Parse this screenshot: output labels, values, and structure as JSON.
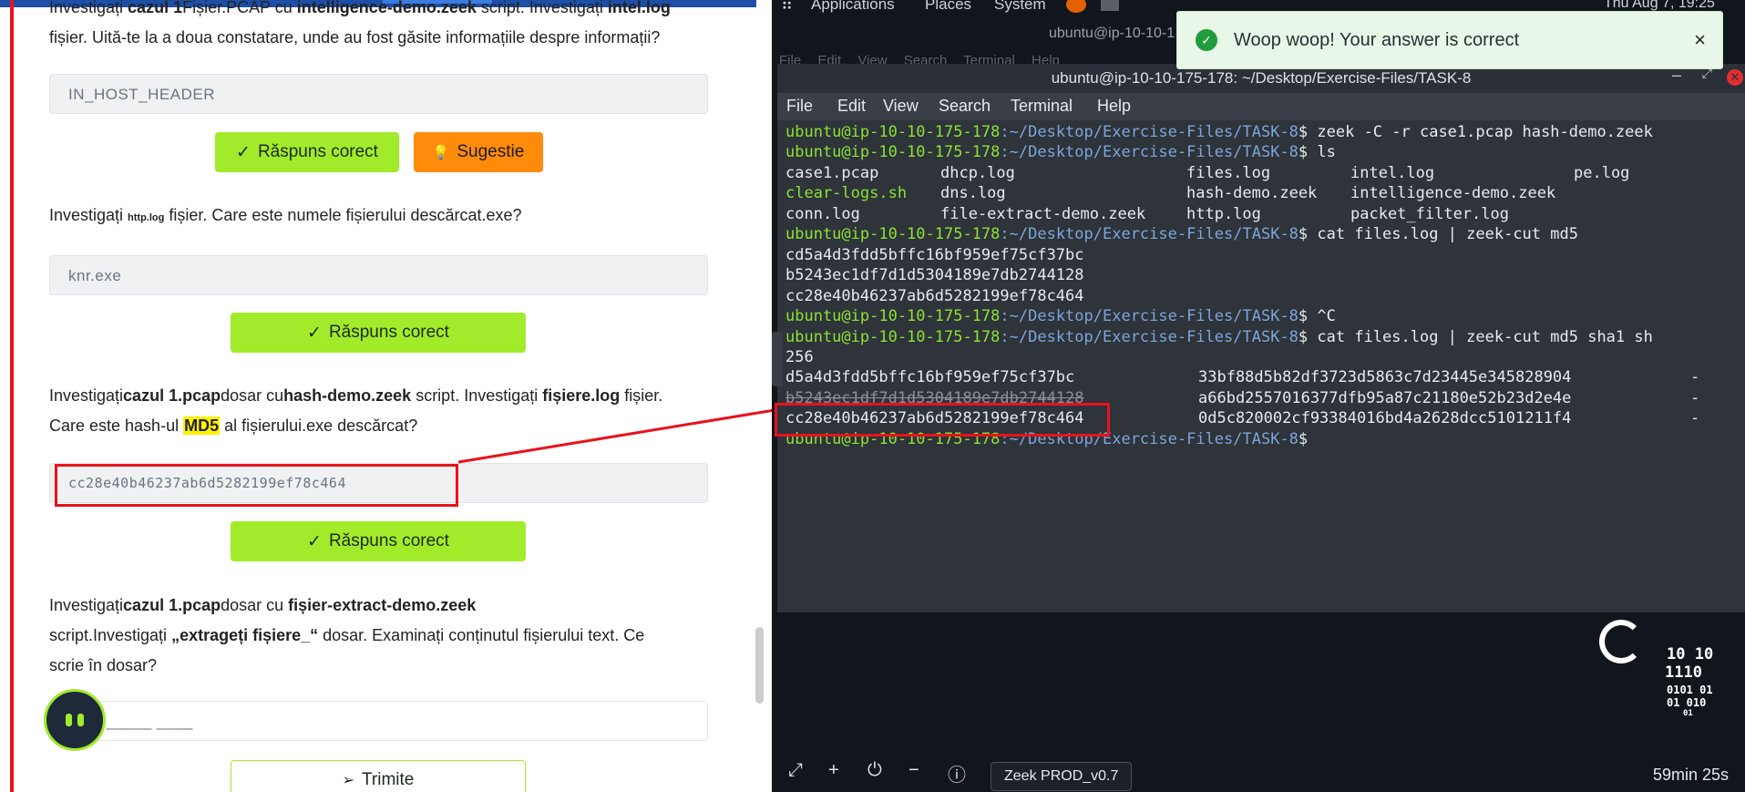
{
  "left": {
    "q1_text_a": "Investigați ",
    "q1_bold_a": "cazul 1",
    "q1_text_b": "Fișier.PCAP cu ",
    "q1_bold_b": "intelligence-demo.zeek",
    "q1_text_c": " script. Investigați ",
    "q1_bold_c": "intel.log",
    "q1_line2": "fișier. Uită-te la a doua constatare, unde au fost găsite informațiile despre informații?",
    "q1_answer": "IN_HOST_HEADER",
    "correct_label": "Răspuns corect",
    "hint_label": "Sugestie",
    "q2_text_a": "Investigați ",
    "q2_small": "http.log",
    "q2_text_b": " fișier. Care este numele fișierului descărcat.exe?",
    "q2_answer": "knr.exe",
    "q3_text_a": "Investigați",
    "q3_bold_a": "cazul 1.pcap",
    "q3_text_b": "dosar cu",
    "q3_bold_b": "hash-demo.zeek",
    "q3_text_c": " script. Investigați ",
    "q3_bold_c": "fișiere.log",
    "q3_text_d": " fișier.",
    "q3_line2_a": "Care este hash-ul ",
    "q3_highlight": "MD5",
    "q3_line2_b": " al fișierului.exe descărcat?",
    "q3_answer": "cc28e40b46237ab6d5282199ef78c464",
    "q4_text_a": "Investigați",
    "q4_bold_a": "cazul 1.pcap",
    "q4_text_b": "dosar cu ",
    "q4_bold_b": "fișier-extract-demo.zeek",
    "q4_line2_a": "script.Investigați ",
    "q4_bold_c": "„extrageți fișiere_“",
    "q4_line2_b": " dosar. Examinați conținutul fișierului text. Ce",
    "q4_line3": "scrie în dosar?",
    "q4_placeholder": "_____ ____",
    "submit_label": "Trimite"
  },
  "desktop": {
    "menu_applications": "Applications",
    "menu_places": "Places",
    "menu_system": "System",
    "clock": "Thu Aug 7, 19:25",
    "bg_title": "ubuntu@ip-10-10-1",
    "bg_menu": "File  Edit  View  Search  Terminal  Help"
  },
  "terminal": {
    "title": "ubuntu@ip-10-10-175-178: ~/Desktop/Exercise-Files/TASK-8",
    "menu": [
      "File",
      "Edit",
      "View",
      "Search",
      "Terminal",
      "Help"
    ],
    "prompt_host": "ubuntu@ip-10-10-175-178",
    "prompt_path": ":~/Desktop/Exercise-Files/TASK-8",
    "cmd1": "$ zeek -C -r case1.pcap hash-demo.zeek",
    "cmd2": "$ ls",
    "ls_row1": [
      "case1.pcap",
      "dhcp.log",
      "files.log",
      "intel.log",
      "pe.log"
    ],
    "ls_row2": [
      "clear-logs.sh",
      "dns.log",
      "hash-demo.zeek",
      "intelligence-demo.zeek"
    ],
    "ls_row3": [
      "conn.log",
      "file-extract-demo.zeek",
      "http.log",
      "packet_filter.log"
    ],
    "cmd3": "$ cat files.log | zeek-cut md5",
    "md5_1": "cd5a4d3fdd5bffc16bf959ef75cf37bc",
    "md5_2": "b5243ec1df7d1d5304189e7db2744128",
    "md5_3": "cc28e40b46237ab6d5282199ef78c464",
    "cmd4": "$ ^C",
    "cmd5": "$ cat files.log | zeek-cut md5 sha1 sh",
    "cmd5_cont": "256",
    "row1_md5": "d5a4d3fdd5bffc16bf959ef75cf37bc",
    "row1_sha1": "33bf88d5b82df3723d5863c7d23445e345828904",
    "row2_md5": "b5243ec1df7d1d5304189e7db2744128",
    "row2_sha1": "a66bd2557016377dfb95a87c21180e52b23d2e4e",
    "row3_md5": "cc28e40b46237ab6d5282199ef78c464",
    "row3_sha1": "0d5c820002cf93384016bd4a2628dcc5101211f4",
    "dash": "-",
    "cmd6": "$"
  },
  "toast": {
    "message": "Woop woop! Your answer is correct"
  },
  "dock": {
    "tab_label": "Zeek PROD_v0.7",
    "timer": "59min 25s"
  },
  "logo": {
    "line1": "10 10",
    "line2": "1110",
    "line3": "0101 01",
    "line4": "01 010",
    "line5": "01"
  }
}
